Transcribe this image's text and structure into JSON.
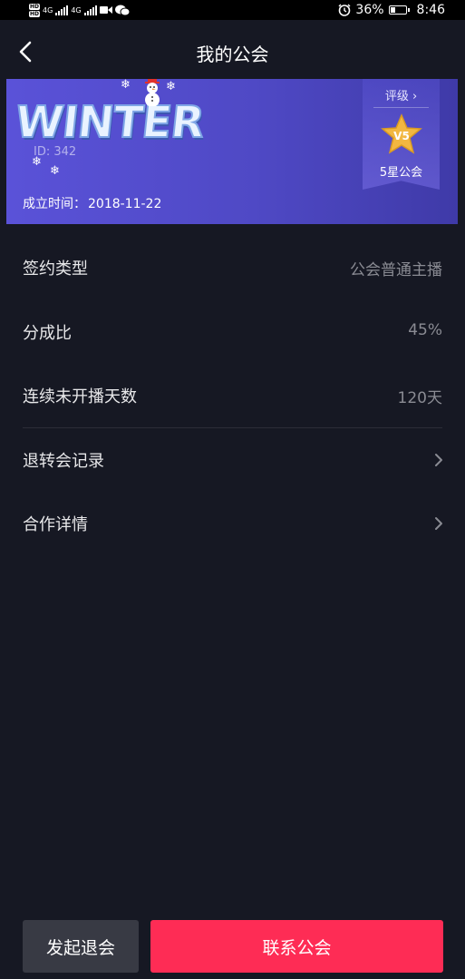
{
  "status_bar": {
    "hd_labels": [
      "HD",
      "HD"
    ],
    "network_1": "4G",
    "network_2": "4G",
    "battery": "36%",
    "battery_level": 0.36,
    "time": "8:46"
  },
  "nav": {
    "title": "我的公会"
  },
  "banner": {
    "guild_name": "WINTER",
    "guild_id": "ID: 342",
    "founded_label": "成立时间：",
    "founded_value": "2018-11-22",
    "rating_link": "评级 ›",
    "star_level": "V5",
    "rating_text": "5星公会"
  },
  "rows": [
    {
      "label": "签约类型",
      "value": "公会普通主播"
    },
    {
      "label": "分成比",
      "value": "45%"
    },
    {
      "label": "连续未开播天数",
      "value": "120天"
    },
    {
      "label": "退转会记录",
      "value": ""
    },
    {
      "label": "合作详情",
      "value": ""
    }
  ],
  "buttons": {
    "leave": "发起退会",
    "contact": "联系公会"
  },
  "colors": {
    "background": "#161823",
    "banner": "#5a52d8",
    "primary_button": "#fe2c55",
    "secondary_button": "#383a44"
  }
}
